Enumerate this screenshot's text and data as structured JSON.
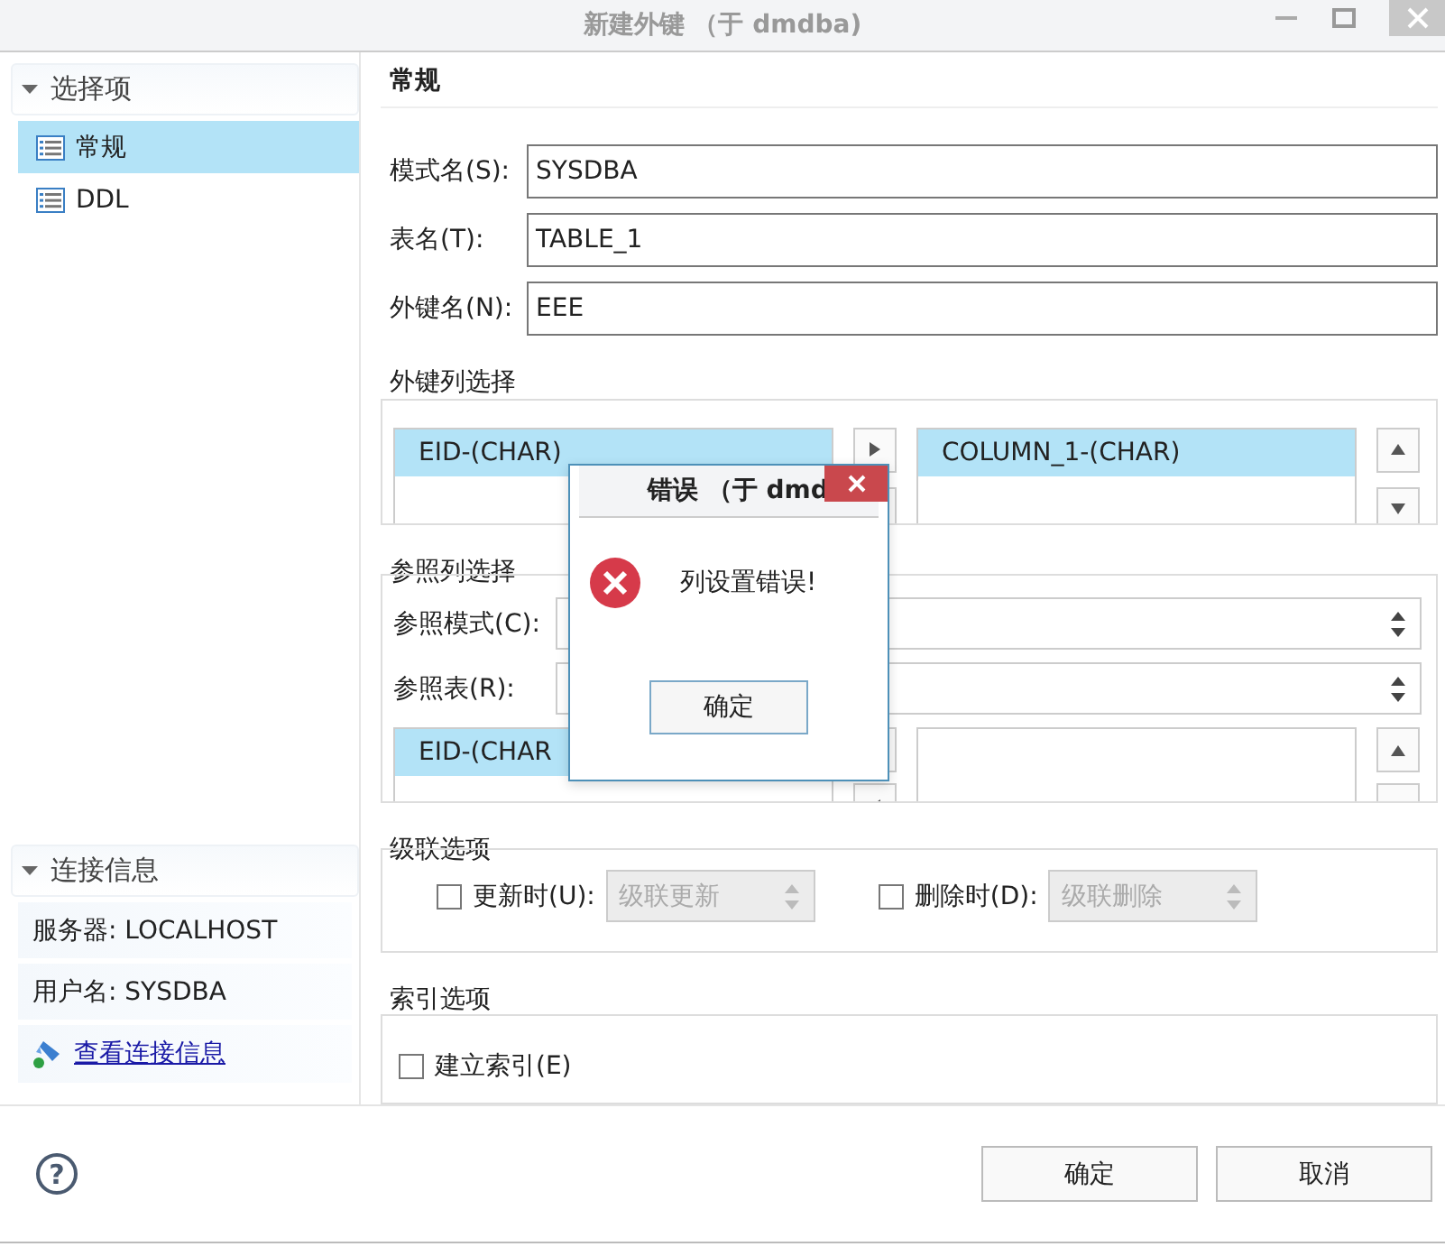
{
  "window": {
    "title": "新建外键 （于 dmdba)"
  },
  "sidebar": {
    "nav": {
      "title": "选择项",
      "expanded": true,
      "items": [
        {
          "label": "常规",
          "selected": true
        },
        {
          "label": "DDL",
          "selected": false
        }
      ]
    },
    "connection": {
      "title": "连接信息",
      "expanded": true,
      "rows": [
        "服务器: LOCALHOST",
        "用户名: SYSDBA"
      ],
      "link": "查看连接信息"
    }
  },
  "section_title": "常规",
  "fields": [
    {
      "label": "模式名(S):",
      "value": "SYSDBA"
    },
    {
      "label": "表名(T):",
      "value": "TABLE_1"
    },
    {
      "label": "外键名(N):",
      "value": "EEE"
    }
  ],
  "fk_columns": {
    "title": "外键列选择",
    "source": [
      {
        "label": "EID-(CHAR)",
        "selected": true
      }
    ],
    "target": [
      {
        "label": "COLUMN_1-(CHAR)",
        "selected": true
      }
    ]
  },
  "ref_columns": {
    "title": "参照列选择",
    "combos": [
      {
        "label": "参照模式(C):"
      },
      {
        "label": "参照表(R):"
      }
    ],
    "source": [
      {
        "label": "EID-(CHAR",
        "selected": true
      }
    ]
  },
  "cascade": {
    "title": "级联选项",
    "options": [
      {
        "label": "更新时(U):",
        "checked": false,
        "value": "级联更新",
        "disabled": true
      },
      {
        "label": "删除时(D):",
        "checked": false,
        "value": "级联删除",
        "disabled": true
      }
    ]
  },
  "index": {
    "title": "索引选项",
    "options": [
      {
        "label": "建立索引(E)",
        "checked": false
      }
    ]
  },
  "help": "?",
  "buttons": [
    {
      "label": "确定"
    },
    {
      "label": "取消"
    }
  ],
  "dialog": {
    "title": "错误 （于 dmd",
    "message": "列设置错误!",
    "button": "确定"
  }
}
